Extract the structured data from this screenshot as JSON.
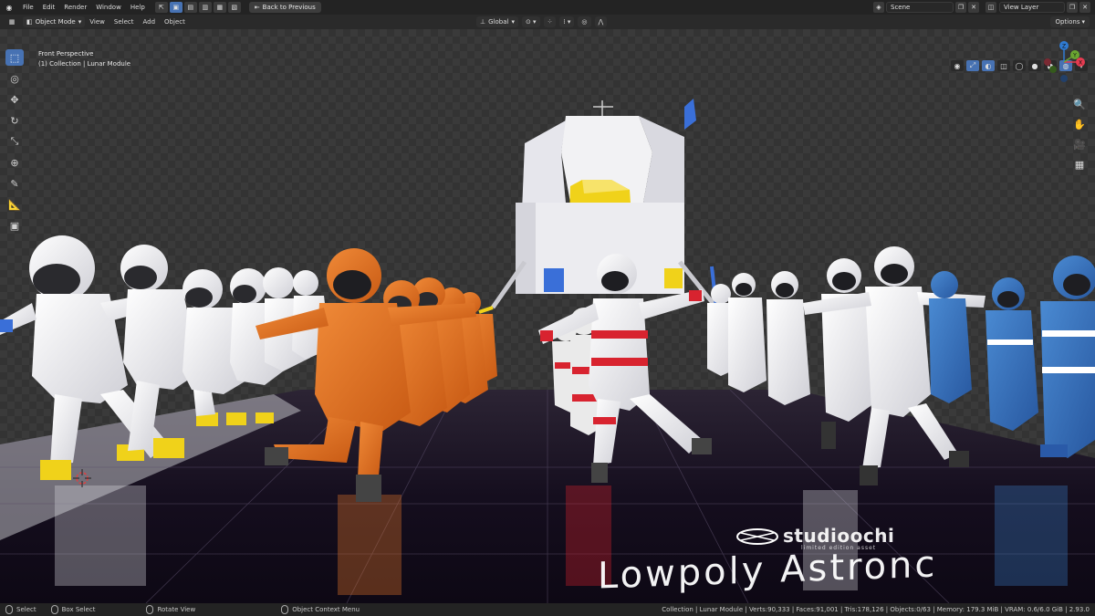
{
  "menu": {
    "items": [
      "File",
      "Edit",
      "Render",
      "Window",
      "Help"
    ],
    "back_button": "Back to Previous"
  },
  "topright": {
    "scene": "Scene",
    "view_layer": "View Layer"
  },
  "header": {
    "mode": "Object Mode",
    "items": [
      "View",
      "Select",
      "Add",
      "Object"
    ],
    "transform_orientation": "Global",
    "options": "Options"
  },
  "viewport": {
    "perspective": "Front Perspective",
    "collection": "(1) Collection | Lunar Module"
  },
  "gizmo": {
    "x_label": "X",
    "y_label": "Y",
    "z_label": "Z",
    "x_color": "#e53b50",
    "y_color": "#6aa531",
    "z_color": "#2f7ad1"
  },
  "watermark": {
    "brand": "studioochi",
    "sub": "limited edition asset",
    "title": "Lowpoly Astronc"
  },
  "status": {
    "select": "Select",
    "box_select": "Box Select",
    "rotate_view": "Rotate View",
    "context_menu": "Object Context Menu",
    "stats": "Collection | Lunar Module | Verts:90,333 | Faces:91,001 | Tris:178,126 | Objects:0/63 | Memory: 179.3 MiB | VRAM: 0.6/6.0 GiB | 2.93.0"
  },
  "colors": {
    "accent": "#4772b3",
    "suit_orange": "#e8782a",
    "suit_blue": "#3a7cc4",
    "suit_red": "#d8232f",
    "visor_gold": "#f0d21a"
  }
}
